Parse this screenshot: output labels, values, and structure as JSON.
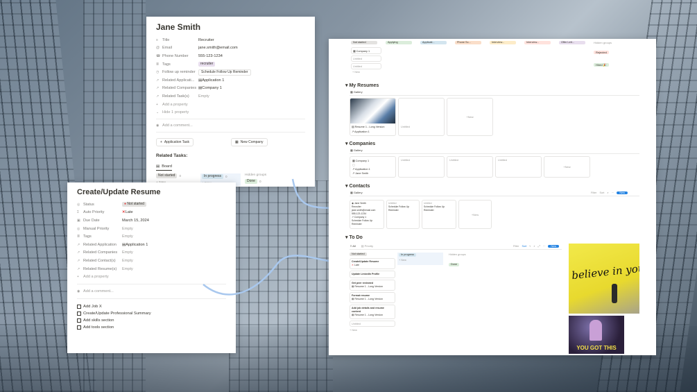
{
  "contact_panel": {
    "title": "Jane Smith",
    "props": [
      {
        "icon": "≡",
        "name": "Title",
        "value": "Recruiter"
      },
      {
        "icon": "@",
        "name": "Email",
        "value": "jane.smith@email.com"
      },
      {
        "icon": "☎",
        "name": "Phone Number",
        "value": "555-123-1234"
      },
      {
        "icon": "≣",
        "name": "Tags",
        "value": "recruiter"
      },
      {
        "icon": "◷",
        "name": "Follow up reminder",
        "value": "Schedule Follow Up Reminder"
      },
      {
        "icon": "↗",
        "name": "Related Applicati...",
        "value": "Application 1"
      },
      {
        "icon": "↗",
        "name": "Related Companies",
        "value": "Company 1"
      },
      {
        "icon": "↗",
        "name": "Related Task(s)",
        "value": "Empty"
      }
    ],
    "add_property": "Add a property",
    "hide_property": "Hide 1 property",
    "add_comment": "Add a comment...",
    "btn_application_task": "Application Task",
    "btn_new_company": "New Company",
    "related_tasks": "Related Tasks:",
    "board_tab": "Board",
    "board_cols": {
      "not_started": "Not started",
      "in_progress": "In progress",
      "hidden_groups": "Hidden groups",
      "done": "Done",
      "count": "0",
      "new": "New"
    }
  },
  "task_panel": {
    "title": "Create/Update Resume",
    "props": [
      {
        "icon": "◎",
        "name": "Status",
        "value": "Not started"
      },
      {
        "icon": "Σ",
        "name": "Auto Priority",
        "value": "Late"
      },
      {
        "icon": "▣",
        "name": "Due Date",
        "value": "March 15, 2024"
      },
      {
        "icon": "◎",
        "name": "Manual Priority",
        "value": "Empty"
      },
      {
        "icon": "≣",
        "name": "Tags",
        "value": "Empty"
      },
      {
        "icon": "↗",
        "name": "Related Application",
        "value": "Application 1"
      },
      {
        "icon": "↗",
        "name": "Related Companies",
        "value": "Empty"
      },
      {
        "icon": "↗",
        "name": "Related Contact(s)",
        "value": "Empty"
      },
      {
        "icon": "↗",
        "name": "Related Resume(s)",
        "value": "Empty"
      }
    ],
    "add_property": "Add a property",
    "add_comment": "Add a comment...",
    "todos": [
      "Add Job X",
      "Create/Update Professional Summary",
      "Add skills section",
      "Add tools section"
    ]
  },
  "dashboard": {
    "top_board_cols": [
      "Not started",
      "Applying",
      "Applicati...",
      "Phone Sc...",
      "Interview...",
      "Interview...",
      "Offer Lett..."
    ],
    "top_hidden_groups": "Hidden groups",
    "top_hidden": [
      "Rejected",
      "Hired 🎉"
    ],
    "top_card": "Company 1",
    "untitled": "Untitled",
    "new": "New",
    "my_resumes": "My Resumes",
    "gallery": "Gallery",
    "resume_card": {
      "title": "Resume 1 - Long Version",
      "app": "Application 1"
    },
    "companies": "Companies",
    "company_card": {
      "title": "Company 1",
      "app": "Application 1",
      "contact": "Jane Smith"
    },
    "contacts": "Contacts",
    "contact_card": {
      "name": "Jane Smith",
      "role": "Recruiter",
      "email": "jane.smith@email.com",
      "phone": "555-123-1234",
      "company": "Company 1",
      "reminder": "Schedule Follow Up Reminder"
    },
    "reminder_short": "Schedule Follow Up Reminder",
    "toolbar": {
      "filter": "Filter",
      "sort": "Sort",
      "new": "New"
    },
    "todo": "To Do",
    "todo_tabs": [
      "All",
      "Priority"
    ],
    "todo_cols": {
      "not_started": "Not started",
      "in_progress": "In progress",
      "hidden_groups": "Hidden groups",
      "done": "Done"
    },
    "todo_cards": [
      {
        "title": "Create/Update Resume",
        "sub": "Late"
      },
      {
        "title": "Update LinkedIn Profile",
        "sub": ""
      },
      {
        "title": "Get peer reviewed",
        "sub": "Resume 1 - Long Version"
      },
      {
        "title": "Format resume",
        "sub": "Resume 1 - Long Version"
      },
      {
        "title": "Add job details and resume content",
        "sub": "Resume 1 - Long Version"
      }
    ]
  },
  "images": {
    "believe_text": "believe in yourself",
    "you_got_this": "YOU GOT THIS"
  }
}
